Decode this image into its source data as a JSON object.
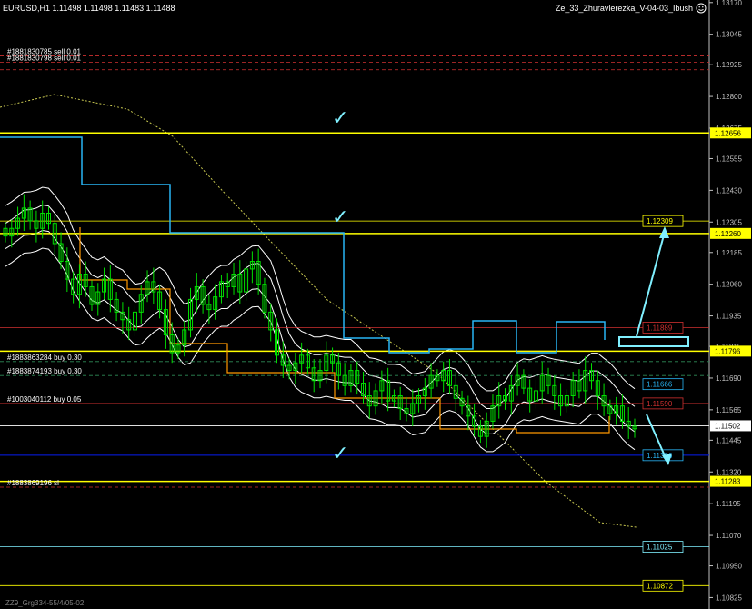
{
  "header": {
    "symbol_info": "EURUSD,H1  1.11498 1.11498 1.11483 1.11488",
    "expert_name": "Ze_33_Zhuravlerezka_V-04-03_Ibush",
    "smiley_icon": "smiley-face-icon"
  },
  "footer": {
    "text": "ZZ9_Grg334-55/4/05-02"
  },
  "colors": {
    "background": "#000000",
    "candle": "#00e000",
    "price_axis_text": "#c0c0c0",
    "blue_line": "#29b6f6",
    "yellow_level": "#ffff00",
    "white_level": "#ffffff",
    "red_level": "#d03030",
    "band": "#ffffff",
    "orange": "#ff9800",
    "cyan_arrow": "#80f0ff",
    "navy": "#0000cc"
  },
  "chart_data": {
    "type": "candlestick",
    "symbol": "EURUSD",
    "timeframe": "H1",
    "last_bar": {
      "open": 1.11498,
      "high": 1.11498,
      "low": 1.11483,
      "close": 1.11488
    },
    "ylim": [
      1.1078,
      1.1318
    ],
    "price_ticks": [
      "1.13170",
      "1.13045",
      "1.12925",
      "1.12800",
      "1.12675",
      "1.12555",
      "1.12430",
      "1.12305",
      "1.12185",
      "1.12060",
      "1.11935",
      "1.11815",
      "1.11690",
      "1.11565",
      "1.11445",
      "1.11320",
      "1.11195",
      "1.11070",
      "1.10950",
      "1.10825"
    ],
    "current_price_label": "1.11502",
    "current_price": 1.11502,
    "levels": [
      {
        "price": 1.12656,
        "label": "1.12656",
        "color": "#ffff00",
        "axis_box": true
      },
      {
        "price": 1.1226,
        "label": "1.12260",
        "color": "#ffff00",
        "axis_box": true
      },
      {
        "price": 1.11796,
        "label": "1.11796",
        "color": "#ffff00",
        "axis_box": true
      },
      {
        "price": 1.11283,
        "label": "1.11283",
        "color": "#ffff00",
        "axis_box": true
      },
      {
        "price": 1.12309,
        "label": "1.12309",
        "color": "#ffff00",
        "axis_box": false
      },
      {
        "price": 1.11889,
        "label": "1.11889",
        "color": "#d03030",
        "axis_box": false
      },
      {
        "price": 1.11666,
        "label": "1.11666",
        "color": "#29b6f6",
        "axis_box": false
      },
      {
        "price": 1.1159,
        "label": "1.11590",
        "color": "#d03030",
        "axis_box": false
      },
      {
        "price": 1.11386,
        "label": "1.11386",
        "color": "#29b6f6",
        "axis_box": false
      },
      {
        "price": 1.11025,
        "label": "1.11025",
        "color": "#80f0ff",
        "axis_box": false
      },
      {
        "price": 1.10872,
        "label": "1.10872",
        "color": "#ffff00",
        "axis_box": false
      }
    ],
    "order_labels": [
      {
        "text": "#1881830785 sell 0.01",
        "price": 1.1296
      },
      {
        "text": "#1881830798 sell 0.01",
        "price": 1.12935
      },
      {
        "text": "#1883863284 buy 0.30",
        "price": 1.11755
      },
      {
        "text": "#1883874193 buy 0.30",
        "price": 1.117
      },
      {
        "text": "#1003040112 buy 0.05",
        "price": 1.1159
      },
      {
        "text": "#1883869196 sl",
        "price": 1.1126
      }
    ],
    "closes": [
      1.1225,
      1.1228,
      1.1232,
      1.1236,
      1.1231,
      1.1228,
      1.1234,
      1.123,
      1.1222,
      1.1215,
      1.1208,
      1.1202,
      1.121,
      1.1205,
      1.1198,
      1.1203,
      1.1208,
      1.12,
      1.1195,
      1.1192,
      1.1188,
      1.1195,
      1.1202,
      1.1207,
      1.1203,
      1.1196,
      1.1186,
      1.1179,
      1.1182,
      1.1188,
      1.12,
      1.1205,
      1.1198,
      1.1196,
      1.1201,
      1.1207,
      1.1205,
      1.121,
      1.1203,
      1.1212,
      1.1215,
      1.1206,
      1.1195,
      1.1188,
      1.1178,
      1.1174,
      1.1172,
      1.1175,
      1.1178,
      1.1173,
      1.1168,
      1.1172,
      1.1178,
      1.1175,
      1.117,
      1.1166,
      1.1172,
      1.1167,
      1.1162,
      1.1158,
      1.1164,
      1.1168,
      1.116,
      1.1162,
      1.1157,
      1.1155,
      1.1159,
      1.1162,
      1.1165,
      1.117,
      1.1168,
      1.1172,
      1.1166,
      1.1161,
      1.1158,
      1.1154,
      1.115,
      1.1146,
      1.1152,
      1.1158,
      1.1162,
      1.116,
      1.1166,
      1.117,
      1.1165,
      1.116,
      1.1164,
      1.117,
      1.1166,
      1.1162,
      1.1158,
      1.1162,
      1.1168,
      1.1164,
      1.1172,
      1.1168,
      1.1162,
      1.1158,
      1.1155,
      1.1158,
      1.1152,
      1.115,
      1.1149
    ]
  },
  "annotations": {
    "checkmarks": [
      {
        "text": "✓",
        "position": "top"
      },
      {
        "text": "✓",
        "position": "middle"
      },
      {
        "text": "✓",
        "position": "bottom"
      }
    ]
  }
}
